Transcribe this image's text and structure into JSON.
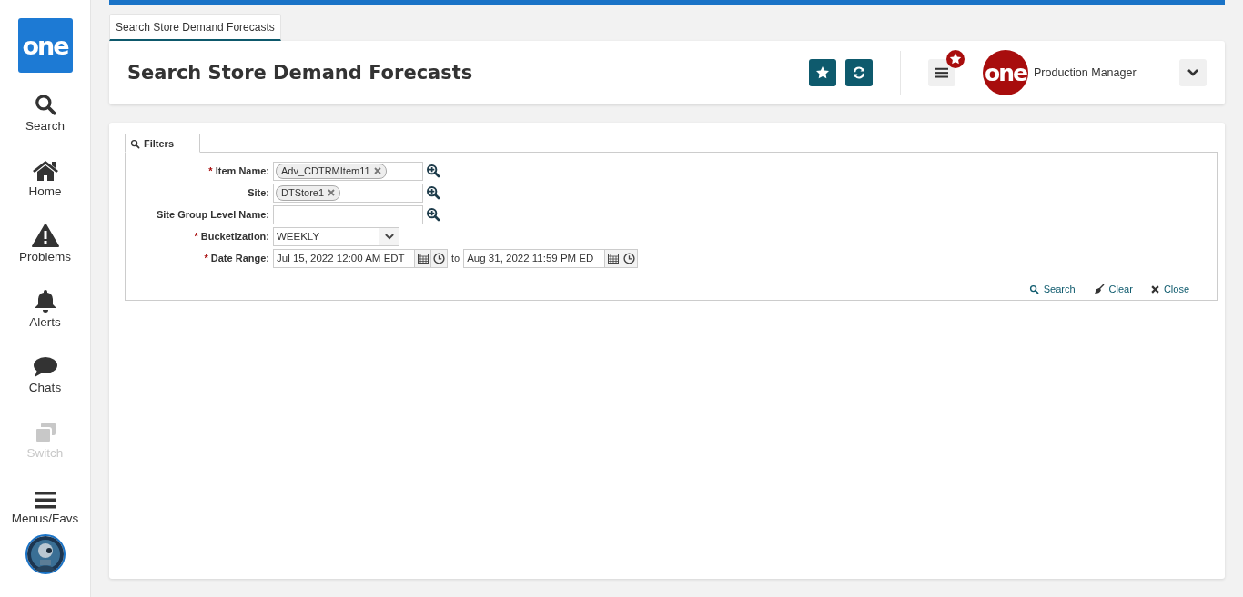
{
  "sidebar": {
    "logo": "one",
    "items": [
      {
        "label": "Search",
        "disabled": false
      },
      {
        "label": "Home",
        "disabled": false
      },
      {
        "label": "Problems",
        "disabled": false
      },
      {
        "label": "Alerts",
        "disabled": false
      },
      {
        "label": "Chats",
        "disabled": false
      },
      {
        "label": "Switch",
        "disabled": true
      },
      {
        "label": "Menus/Favs",
        "disabled": false
      }
    ]
  },
  "page_tabs": [
    {
      "label": "Search Store Demand Forecasts",
      "selected": true
    }
  ],
  "header": {
    "title": "Search Store Demand Forecasts",
    "user": {
      "logo": "one",
      "role": "Production Manager"
    }
  },
  "filters": {
    "tab": "Filters",
    "fields": [
      {
        "kind": "lookup",
        "required_mark": "*",
        "label": "Item Name:",
        "chips": [
          "Adv_CDTRMItem11"
        ]
      },
      {
        "kind": "lookup",
        "label": "Site:",
        "chips": [
          "DTStore1"
        ]
      },
      {
        "kind": "lookup",
        "label": "Site Group Level Name:"
      },
      {
        "kind": "select",
        "required_mark": "*",
        "label": "Bucketization:",
        "value": "WEEKLY"
      },
      {
        "kind": "daterange",
        "required_mark": "*",
        "label": "Date Range:",
        "from": "Jul 15, 2022 12:00 AM EDT",
        "separator": "to",
        "to": "Aug 31, 2022 11:59 PM ED"
      }
    ],
    "actions": [
      "Search",
      "Clear",
      "Close"
    ]
  }
}
